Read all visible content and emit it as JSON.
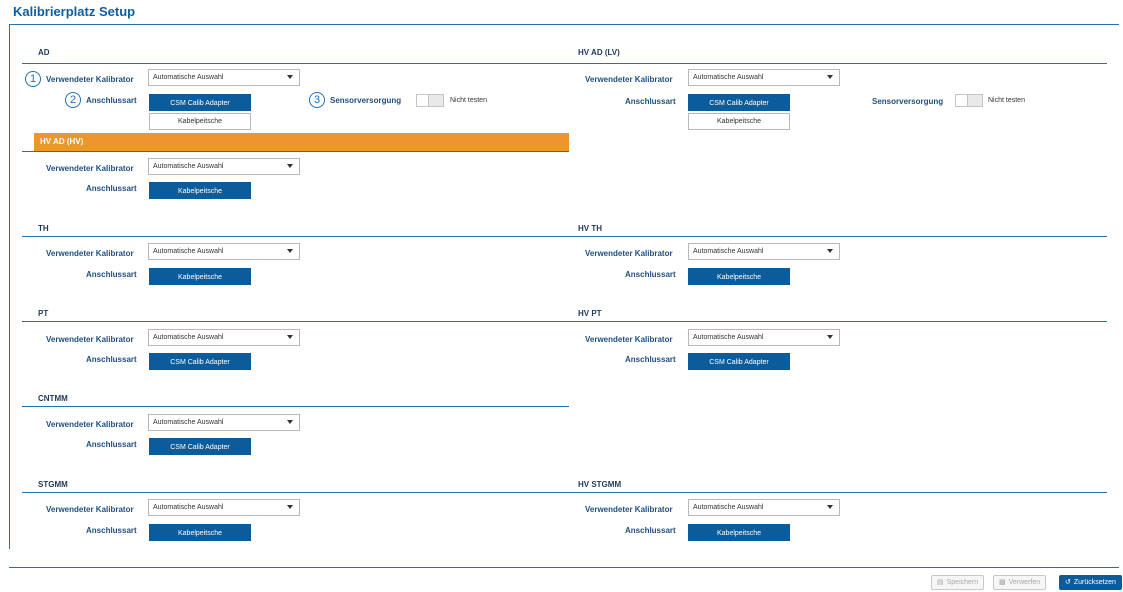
{
  "page": {
    "title": "Kalibrierplatz Setup"
  },
  "labels": {
    "calibrator": "Verwendeter Kalibrator",
    "connection": "Anschlussart",
    "sensor_supply": "Sensorversorgung",
    "not_test": "Nicht testen"
  },
  "options": {
    "auto_select": "Automatische Auswahl",
    "csm_adapter": "CSM Calib Adapter",
    "kabelpeitsche": "Kabelpeitsche"
  },
  "markers": [
    "1",
    "2",
    "3"
  ],
  "sections": {
    "ad": {
      "title": "AD"
    },
    "hv_ad_lv": {
      "title": "HV AD (LV)"
    },
    "hv_ad_hv": {
      "title": "HV AD (HV)"
    },
    "th": {
      "title": "TH"
    },
    "hv_th": {
      "title": "HV TH"
    },
    "pt": {
      "title": "PT"
    },
    "hv_pt": {
      "title": "HV PT"
    },
    "cntmm": {
      "title": "CNTMM"
    },
    "stgmm": {
      "title": "STGMM"
    },
    "hv_stgmm": {
      "title": "HV STGMM"
    }
  },
  "footer": {
    "save": "Speichern",
    "discard": "Verwerfen",
    "reset": "Zurücksetzen"
  },
  "colors": {
    "accent": "#0c5c9c",
    "highlight": "#f0952b",
    "rule": "#2a6fa8"
  }
}
